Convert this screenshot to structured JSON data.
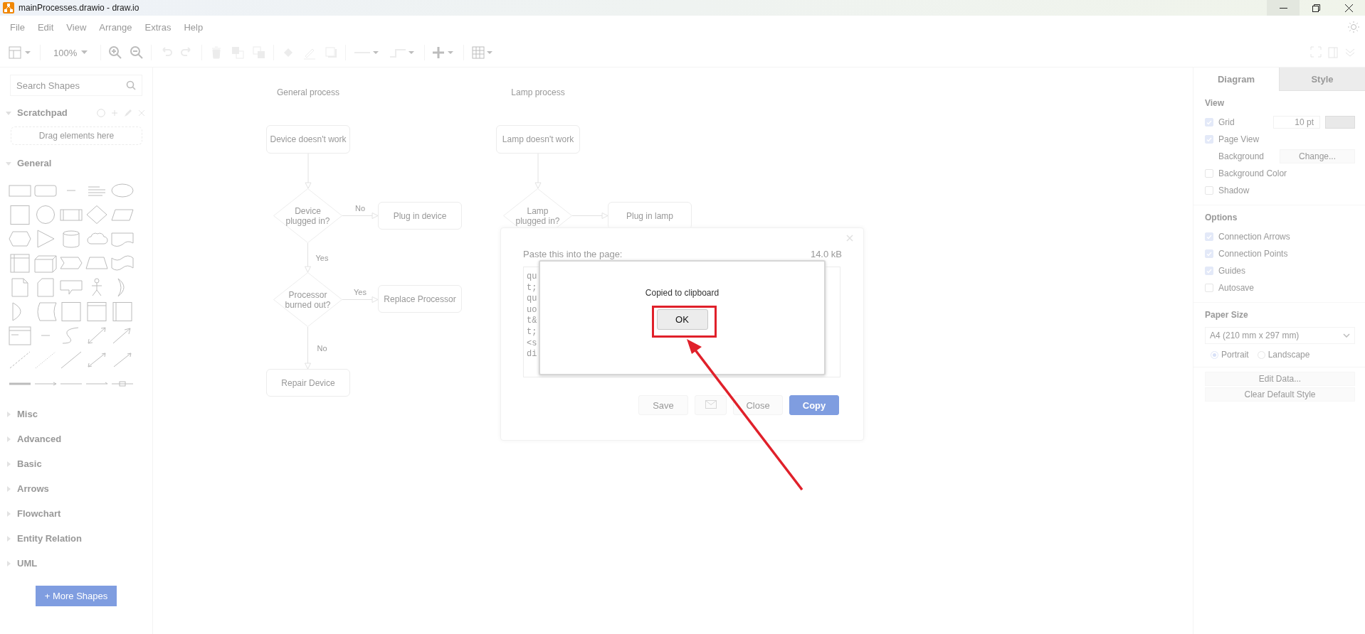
{
  "window": {
    "title": "mainProcesses.drawio - draw.io"
  },
  "menu": [
    {
      "label": "File"
    },
    {
      "label": "Edit"
    },
    {
      "label": "View"
    },
    {
      "label": "Arrange"
    },
    {
      "label": "Extras"
    },
    {
      "label": "Help"
    }
  ],
  "toolbar": {
    "zoom": "100%"
  },
  "sidebar": {
    "search": {
      "placeholder": "Search Shapes"
    },
    "scratchpad": {
      "title": "Scratchpad",
      "hint": "Drag elements here"
    },
    "sections": [
      {
        "title": "General",
        "expanded": true
      },
      {
        "title": "Misc",
        "expanded": false
      },
      {
        "title": "Advanced",
        "expanded": false
      },
      {
        "title": "Basic",
        "expanded": false
      },
      {
        "title": "Arrows",
        "expanded": false
      },
      {
        "title": "Flowchart",
        "expanded": false
      },
      {
        "title": "Entity Relation",
        "expanded": false
      },
      {
        "title": "UML",
        "expanded": false
      }
    ],
    "more_shapes": "+ More Shapes"
  },
  "diagram": {
    "processes": [
      {
        "title": "General process",
        "nodes": [
          {
            "kind": "box",
            "text": "Device doesn't work"
          },
          {
            "kind": "diamond",
            "text": "Device plugged in?"
          },
          {
            "kind": "box",
            "text": "Plug in device"
          },
          {
            "kind": "diamond",
            "text": "Processor burned out?"
          },
          {
            "kind": "box",
            "text": "Replace Processor"
          },
          {
            "kind": "box",
            "text": "Repair Device"
          }
        ],
        "edges": [
          {
            "kind": "arrow"
          },
          {
            "kind": "arrow",
            "label": "No"
          },
          {
            "kind": "arrow",
            "label": "Yes"
          },
          {
            "kind": "arrow",
            "label": "Yes"
          },
          {
            "kind": "arrow",
            "label": "No"
          }
        ]
      },
      {
        "title": "Lamp process",
        "nodes": [
          {
            "kind": "box",
            "text": "Lamp doesn't work"
          },
          {
            "kind": "diamond",
            "text": "Lamp plugged in?"
          },
          {
            "kind": "box",
            "text": "Plug in lamp"
          }
        ],
        "edges": [
          {
            "kind": "arrow"
          },
          {
            "kind": "arrow"
          }
        ]
      }
    ]
  },
  "export_dialog": {
    "label": "Paste this into the page:",
    "size": "14.0 kB",
    "code_lines": [
      "qu",
      "t;",
      "qu",
      "uo",
      "t&",
      "t;",
      "<s",
      "di"
    ],
    "buttons": [
      {
        "kind": "text",
        "label": "Save"
      },
      {
        "kind": "mail"
      },
      {
        "kind": "text",
        "label": "Close"
      },
      {
        "kind": "primary",
        "label": "Copy"
      }
    ]
  },
  "alert": {
    "message": "Copied to clipboard",
    "ok": "OK"
  },
  "format_panel": {
    "tabs": [
      {
        "label": "Diagram",
        "selected": true
      },
      {
        "label": "Style",
        "selected": false
      }
    ],
    "view": {
      "title": "View",
      "items": [
        {
          "kind": "checkbox",
          "label": "Grid",
          "checked": true,
          "value": "10 pt"
        },
        {
          "kind": "checkbox",
          "label": "Page View",
          "checked": true
        },
        {
          "kind": "button-row",
          "label": "Background",
          "button": "Change..."
        },
        {
          "kind": "checkbox",
          "label": "Background Color",
          "checked": false
        },
        {
          "kind": "checkbox",
          "label": "Shadow",
          "checked": false
        }
      ]
    },
    "options": {
      "title": "Options",
      "items": [
        {
          "kind": "checkbox",
          "label": "Connection Arrows",
          "checked": true
        },
        {
          "kind": "checkbox",
          "label": "Connection Points",
          "checked": true
        },
        {
          "kind": "checkbox",
          "label": "Guides",
          "checked": true
        },
        {
          "kind": "checkbox",
          "label": "Autosave",
          "checked": false
        }
      ]
    },
    "paper": {
      "title": "Paper Size",
      "value": "A4 (210 mm x 297 mm)",
      "orientations": [
        {
          "label": "Portrait",
          "selected": true
        },
        {
          "label": "Landscape",
          "selected": false
        }
      ]
    },
    "buttons": [
      {
        "label": "Edit Data..."
      },
      {
        "label": "Clear Default Style"
      }
    ]
  }
}
